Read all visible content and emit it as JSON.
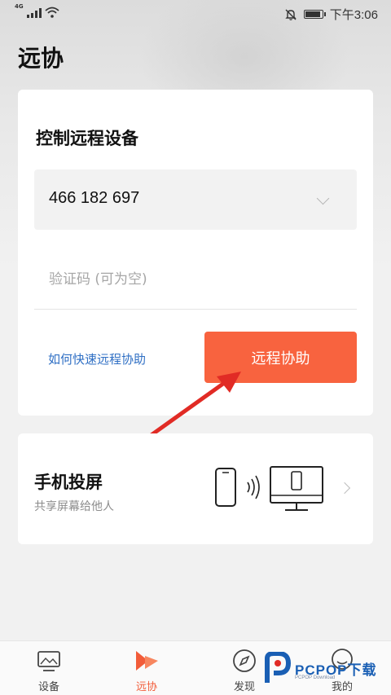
{
  "status_bar": {
    "network": "4G",
    "time": "下午3:06",
    "icons": [
      "signal-icon",
      "wifi-icon",
      "mute-bell-icon",
      "battery-icon"
    ]
  },
  "page": {
    "title": "远协"
  },
  "control_card": {
    "title": "控制远程设备",
    "device_id": "466 182 697",
    "code_placeholder": "验证码 (可为空)",
    "code_value": "",
    "help_link": "如何快速远程协助",
    "assist_button": "远程协助",
    "accent_color": "#f8633f",
    "link_color": "#2f6fc4"
  },
  "cast_card": {
    "title": "手机投屏",
    "subtitle": "共享屏幕给他人"
  },
  "bottom_nav": {
    "active": "远协",
    "items": [
      {
        "label": "设备",
        "icon": "device-screen-icon"
      },
      {
        "label": "远协",
        "icon": "remote-assist-icon"
      },
      {
        "label": "发现",
        "icon": "compass-icon"
      },
      {
        "label": "我的",
        "icon": "profile-icon"
      }
    ]
  },
  "watermark": {
    "brand": "PCPOP下载",
    "sub": "PCPOP Download"
  }
}
